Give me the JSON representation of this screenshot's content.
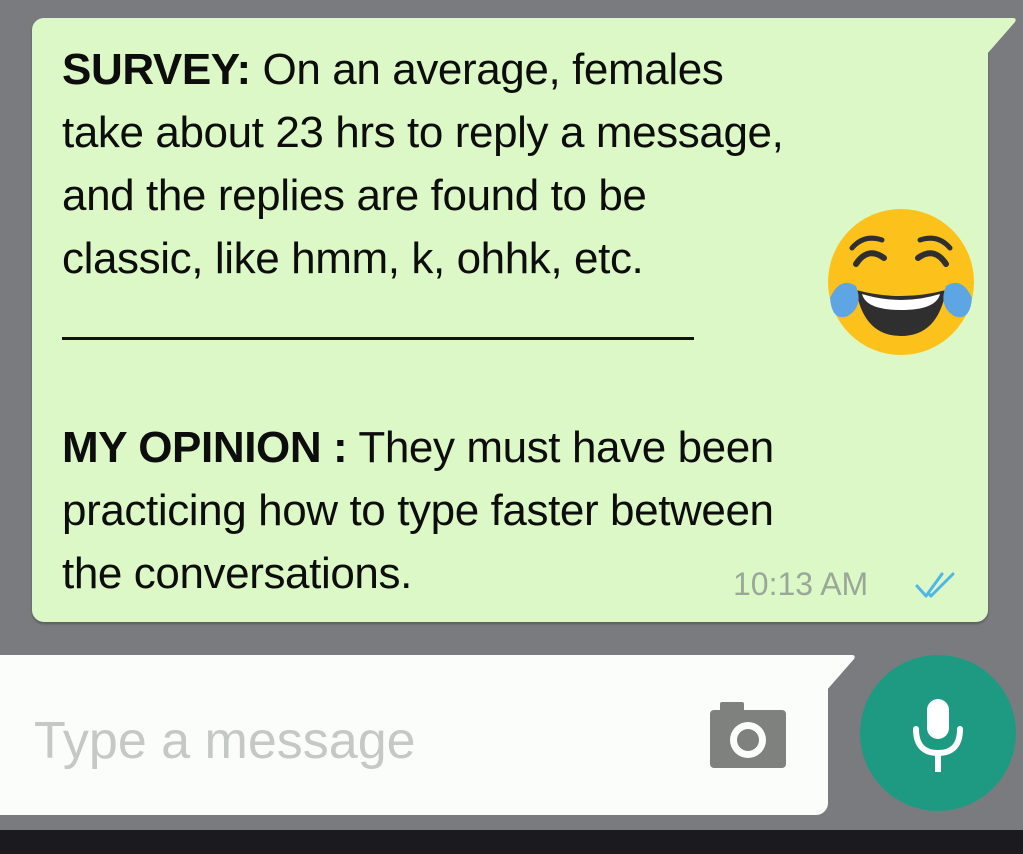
{
  "message": {
    "survey_label": "SURVEY:",
    "survey_lines": [
      " On an average, females",
      "take about 23 hrs to reply a message,",
      "and the replies are found to be",
      "classic, like hmm, k, ohhk, etc."
    ],
    "opinion_label": "MY OPINION :",
    "opinion_lines": [
      " They must have been",
      "practicing how to type faster between",
      "the conversations."
    ],
    "time": "10:13 AM",
    "status": "read",
    "emoji": "face-with-tears-of-joy-emoji"
  },
  "composer": {
    "placeholder": "Type a message",
    "value": "",
    "camera_icon": "camera-icon",
    "mic_icon": "microphone-icon"
  },
  "colors": {
    "chat_background": "#7a7b7f",
    "bubble": "#dcf8c6",
    "send_button": "#1e9a82",
    "read_ticks": "#4fb6e8",
    "timestamp": "#9aa89a"
  }
}
